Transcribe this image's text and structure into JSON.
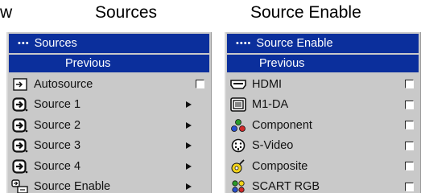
{
  "partial_caption": "w",
  "sources_menu": {
    "caption": "Sources",
    "title": "Sources",
    "title_dots": "•••",
    "previous": "Previous",
    "items": [
      {
        "label": "Autosource",
        "icon": "autosource-icon",
        "control": "checkbox",
        "checked": false
      },
      {
        "label": "Source 1",
        "icon": "source-input-icon",
        "control": "arrow"
      },
      {
        "label": "Source 2",
        "icon": "source-input-icon",
        "control": "arrow"
      },
      {
        "label": "Source 3",
        "icon": "source-input-icon",
        "control": "arrow"
      },
      {
        "label": "Source 4",
        "icon": "source-input-icon",
        "control": "arrow"
      },
      {
        "label": "Source Enable",
        "icon": "source-enable-icon",
        "control": "arrow"
      }
    ]
  },
  "source_enable_menu": {
    "caption": "Source Enable",
    "title": "Source Enable",
    "title_dots": "••••",
    "previous": "Previous",
    "items": [
      {
        "label": "HDMI",
        "icon": "hdmi-icon",
        "checked": false
      },
      {
        "label": "M1-DA",
        "icon": "m1-da-icon",
        "checked": false
      },
      {
        "label": "Component",
        "icon": "component-icon",
        "checked": false
      },
      {
        "label": "S-Video",
        "icon": "s-video-icon",
        "checked": false
      },
      {
        "label": "Composite",
        "icon": "composite-icon",
        "checked": false
      },
      {
        "label": "SCART RGB",
        "icon": "scart-rgb-icon",
        "checked": false
      }
    ]
  },
  "colors": {
    "header_bg": "#0b2f9c",
    "panel_bg": "#c9c9c9"
  }
}
